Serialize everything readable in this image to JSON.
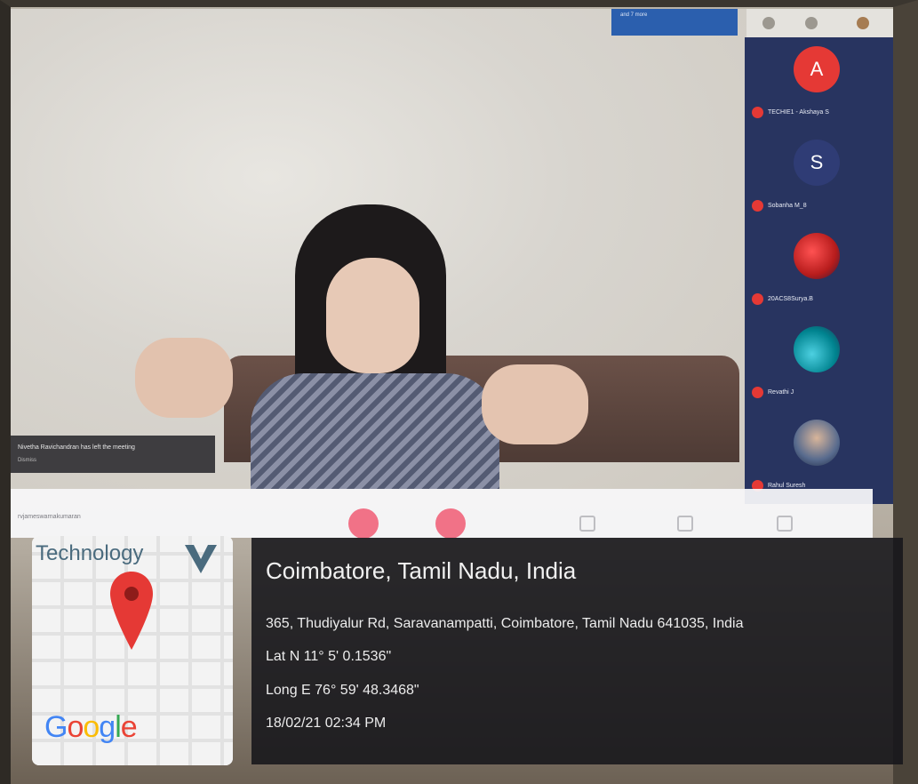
{
  "caption": {
    "city": "Coimbatore, Tamil Nadu, India",
    "address": "365, Thudiyalur Rd, Saravanampatti, Coimbatore, Tamil Nadu 641035, India",
    "latitude": "Lat N 11° 5' 0.1536\"",
    "longitude": "Long E 76° 59' 48.3468\"",
    "datetime": "18/02/21 02:34 PM"
  },
  "map": {
    "brand_text": "Technology",
    "google_letters": [
      "G",
      "o",
      "o",
      "g",
      "l",
      "e"
    ]
  },
  "meeting": {
    "notice_text": "Nivetha Ravichandran has left the meeting",
    "notice_sub": "Dismiss",
    "banner_text": "and 7 more",
    "toolbar_left_text": "rvjameswarnakumaran",
    "participants": [
      {
        "initial": "A",
        "name": "TECHIE1 - Akshaya S",
        "avatar": "red"
      },
      {
        "initial": "S",
        "name": "Sobanha M_8",
        "avatar": "dark"
      },
      {
        "initial": "",
        "name": "20ACS8Surya.B",
        "avatar": "img1"
      },
      {
        "initial": "",
        "name": "Revathi J",
        "avatar": "img2"
      },
      {
        "initial": "",
        "name": "Rahul Suresh",
        "avatar": "img3"
      }
    ]
  },
  "colors": {
    "panel": "#283460",
    "caption_bg": "#16161a",
    "accent_red": "#e53935",
    "toolbar_buttons": "#f05a73"
  }
}
